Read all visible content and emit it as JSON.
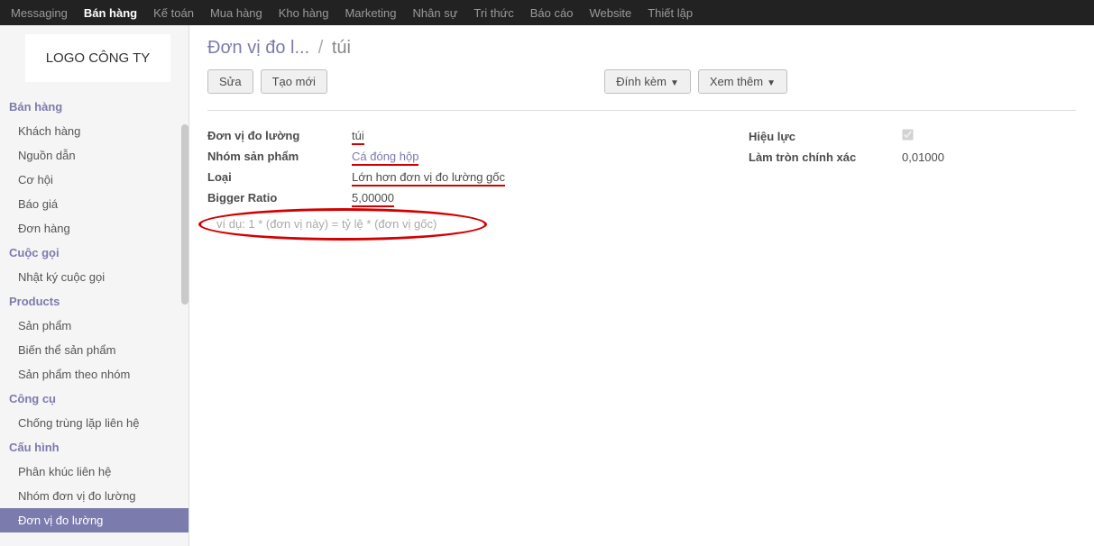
{
  "topnav": {
    "items": [
      {
        "label": "Messaging"
      },
      {
        "label": "Bán hàng",
        "active": true
      },
      {
        "label": "Kế toán"
      },
      {
        "label": "Mua hàng"
      },
      {
        "label": "Kho hàng"
      },
      {
        "label": "Marketing"
      },
      {
        "label": "Nhân sự"
      },
      {
        "label": "Tri thức"
      },
      {
        "label": "Báo cáo"
      },
      {
        "label": "Website"
      },
      {
        "label": "Thiết lập"
      }
    ]
  },
  "logo": "LOGO CÔNG TY",
  "sidebar": {
    "groups": [
      {
        "header": "Bán hàng",
        "items": [
          "Khách hàng",
          "Nguồn dẫn",
          "Cơ hội",
          "Báo giá",
          "Đơn hàng"
        ]
      },
      {
        "header": "Cuộc gọi",
        "items": [
          "Nhật ký cuộc gọi"
        ]
      },
      {
        "header": "Products",
        "items": [
          "Sản phẩm",
          "Biến thể sản phẩm",
          "Sản phẩm theo nhóm"
        ]
      },
      {
        "header": "Công cụ",
        "items": [
          "Chống trùng lặp liên hệ"
        ]
      },
      {
        "header": "Cấu hình",
        "items": [
          "Phân khúc liên hệ",
          "Nhóm đơn vị đo lường",
          "Đơn vị đo lường"
        ]
      }
    ],
    "active": "Đơn vị đo lường"
  },
  "breadcrumb": {
    "parent": "Đơn vị đo l...",
    "sep": "/",
    "current": "túi"
  },
  "toolbar": {
    "edit": "Sửa",
    "create": "Tạo mới",
    "attach": "Đính kèm",
    "more": "Xem thêm"
  },
  "form": {
    "left": {
      "label_uom": "Đơn vị đo lường",
      "value_uom": "túi",
      "label_group": "Nhóm sản phẩm",
      "value_group": "Cá đóng hộp",
      "label_type": "Loại",
      "value_type": "Lớn hơn đơn vị đo lường gốc",
      "label_ratio": "Bigger Ratio",
      "value_ratio": "5,00000"
    },
    "right": {
      "label_active": "Hiệu lực",
      "label_rounding": "Làm tròn chính xác",
      "value_rounding": "0,01000"
    },
    "hint": "ví dụ: 1 * (đơn vị này) = tỷ lệ * (đơn vị gốc)"
  }
}
